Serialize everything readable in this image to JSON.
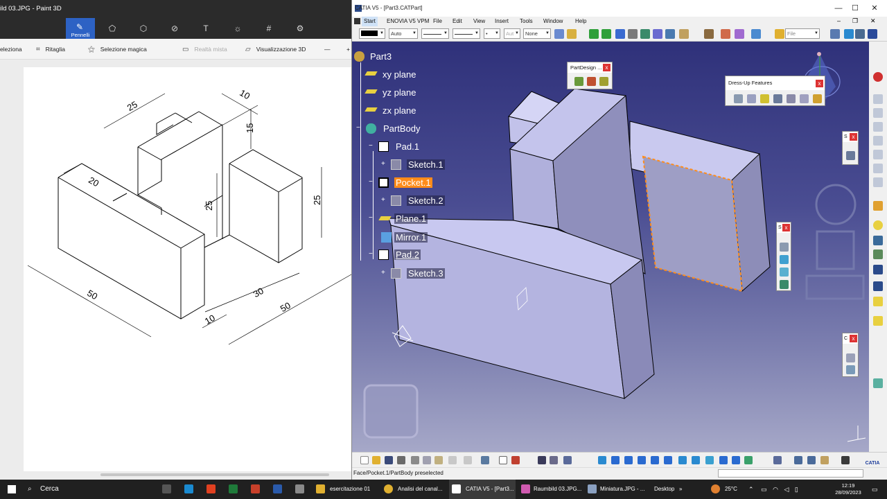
{
  "paint": {
    "title": "ild 03.JPG - Paint 3D",
    "tools": [
      {
        "name": "brush",
        "label": "Pennelli",
        "icon": "brush-icon",
        "active": true
      },
      {
        "name": "shapes2d",
        "label": "",
        "icon": "2d-shapes-icon"
      },
      {
        "name": "shapes3d",
        "label": "",
        "icon": "3d-shapes-icon"
      },
      {
        "name": "stickers",
        "label": "",
        "icon": "stickers-icon"
      },
      {
        "name": "text",
        "label": "",
        "icon": "text-icon"
      },
      {
        "name": "effects",
        "label": "",
        "icon": "effects-icon"
      },
      {
        "name": "canvas",
        "label": "",
        "icon": "canvas-icon"
      },
      {
        "name": "library",
        "label": "",
        "icon": "library-icon"
      }
    ],
    "subtools": {
      "select": "eleziona",
      "crop": "Ritaglia",
      "magic_select": "Selezione magica",
      "mixed_reality": "Realtà mista",
      "view3d": "Visualizzazione 3D",
      "zoom_minus": "—",
      "zoom_plus": "+"
    },
    "drawing_dims": {
      "d25_top": "25",
      "d10_top": "10",
      "d15": "15",
      "d20": "20",
      "d25_mid": "25",
      "d25_right": "25",
      "d50_left": "50",
      "d30": "30",
      "d50_right": "50",
      "d10_bottom": "10"
    }
  },
  "catia": {
    "title": "CATIA V5 - [Part3.CATPart]",
    "window_controls": {
      "minimize": "—",
      "maximize": "☐",
      "close": "✕"
    },
    "menu": [
      "Start",
      "ENOVIA V5 VPM",
      "File",
      "Edit",
      "View",
      "Insert",
      "Tools",
      "Window",
      "Help"
    ],
    "toolbar": {
      "line_style": "Auto",
      "layer": "None",
      "layer_filter": "Aut",
      "dot": "•",
      "file_combo": "File"
    },
    "tree": {
      "root": "Part3",
      "xy": "xy plane",
      "yz": "yz plane",
      "zx": "zx plane",
      "body": "PartBody",
      "pad1": "Pad.1",
      "sketch1": "Sketch.1",
      "pocket1": "Pocket.1",
      "sketch2": "Sketch.2",
      "plane1": "Plane.1",
      "mirror1": "Mirror.1",
      "pad2": "Pad.2",
      "sketch3": "Sketch.3"
    },
    "floating": {
      "partdesign": "PartDesign ...",
      "dressup": "Dress-Up Features",
      "mini1": "S",
      "mini2": "S",
      "mini3": "C",
      "close": "x"
    },
    "status": "Face/Pocket.1/PartBody preselected",
    "logo": "CATIA"
  },
  "taskbar": {
    "search": "Cerca",
    "apps": [
      "esercitazione 01",
      "Analisi del canal...",
      "CATIA V5 - [Part3...",
      "Raumbild 03.JPG...",
      "Miniatura.JPG - ...",
      "Desktop"
    ],
    "weather": "25°C",
    "time": "12:19",
    "date": "28/09/2023"
  },
  "colors": {
    "viewport_top": "#2f317a",
    "viewport_bottom": "#a6a8c8",
    "solid_face": "#c8c8f0",
    "highlight": "#ff8c1a",
    "paint_accent": "#2d62c4"
  }
}
